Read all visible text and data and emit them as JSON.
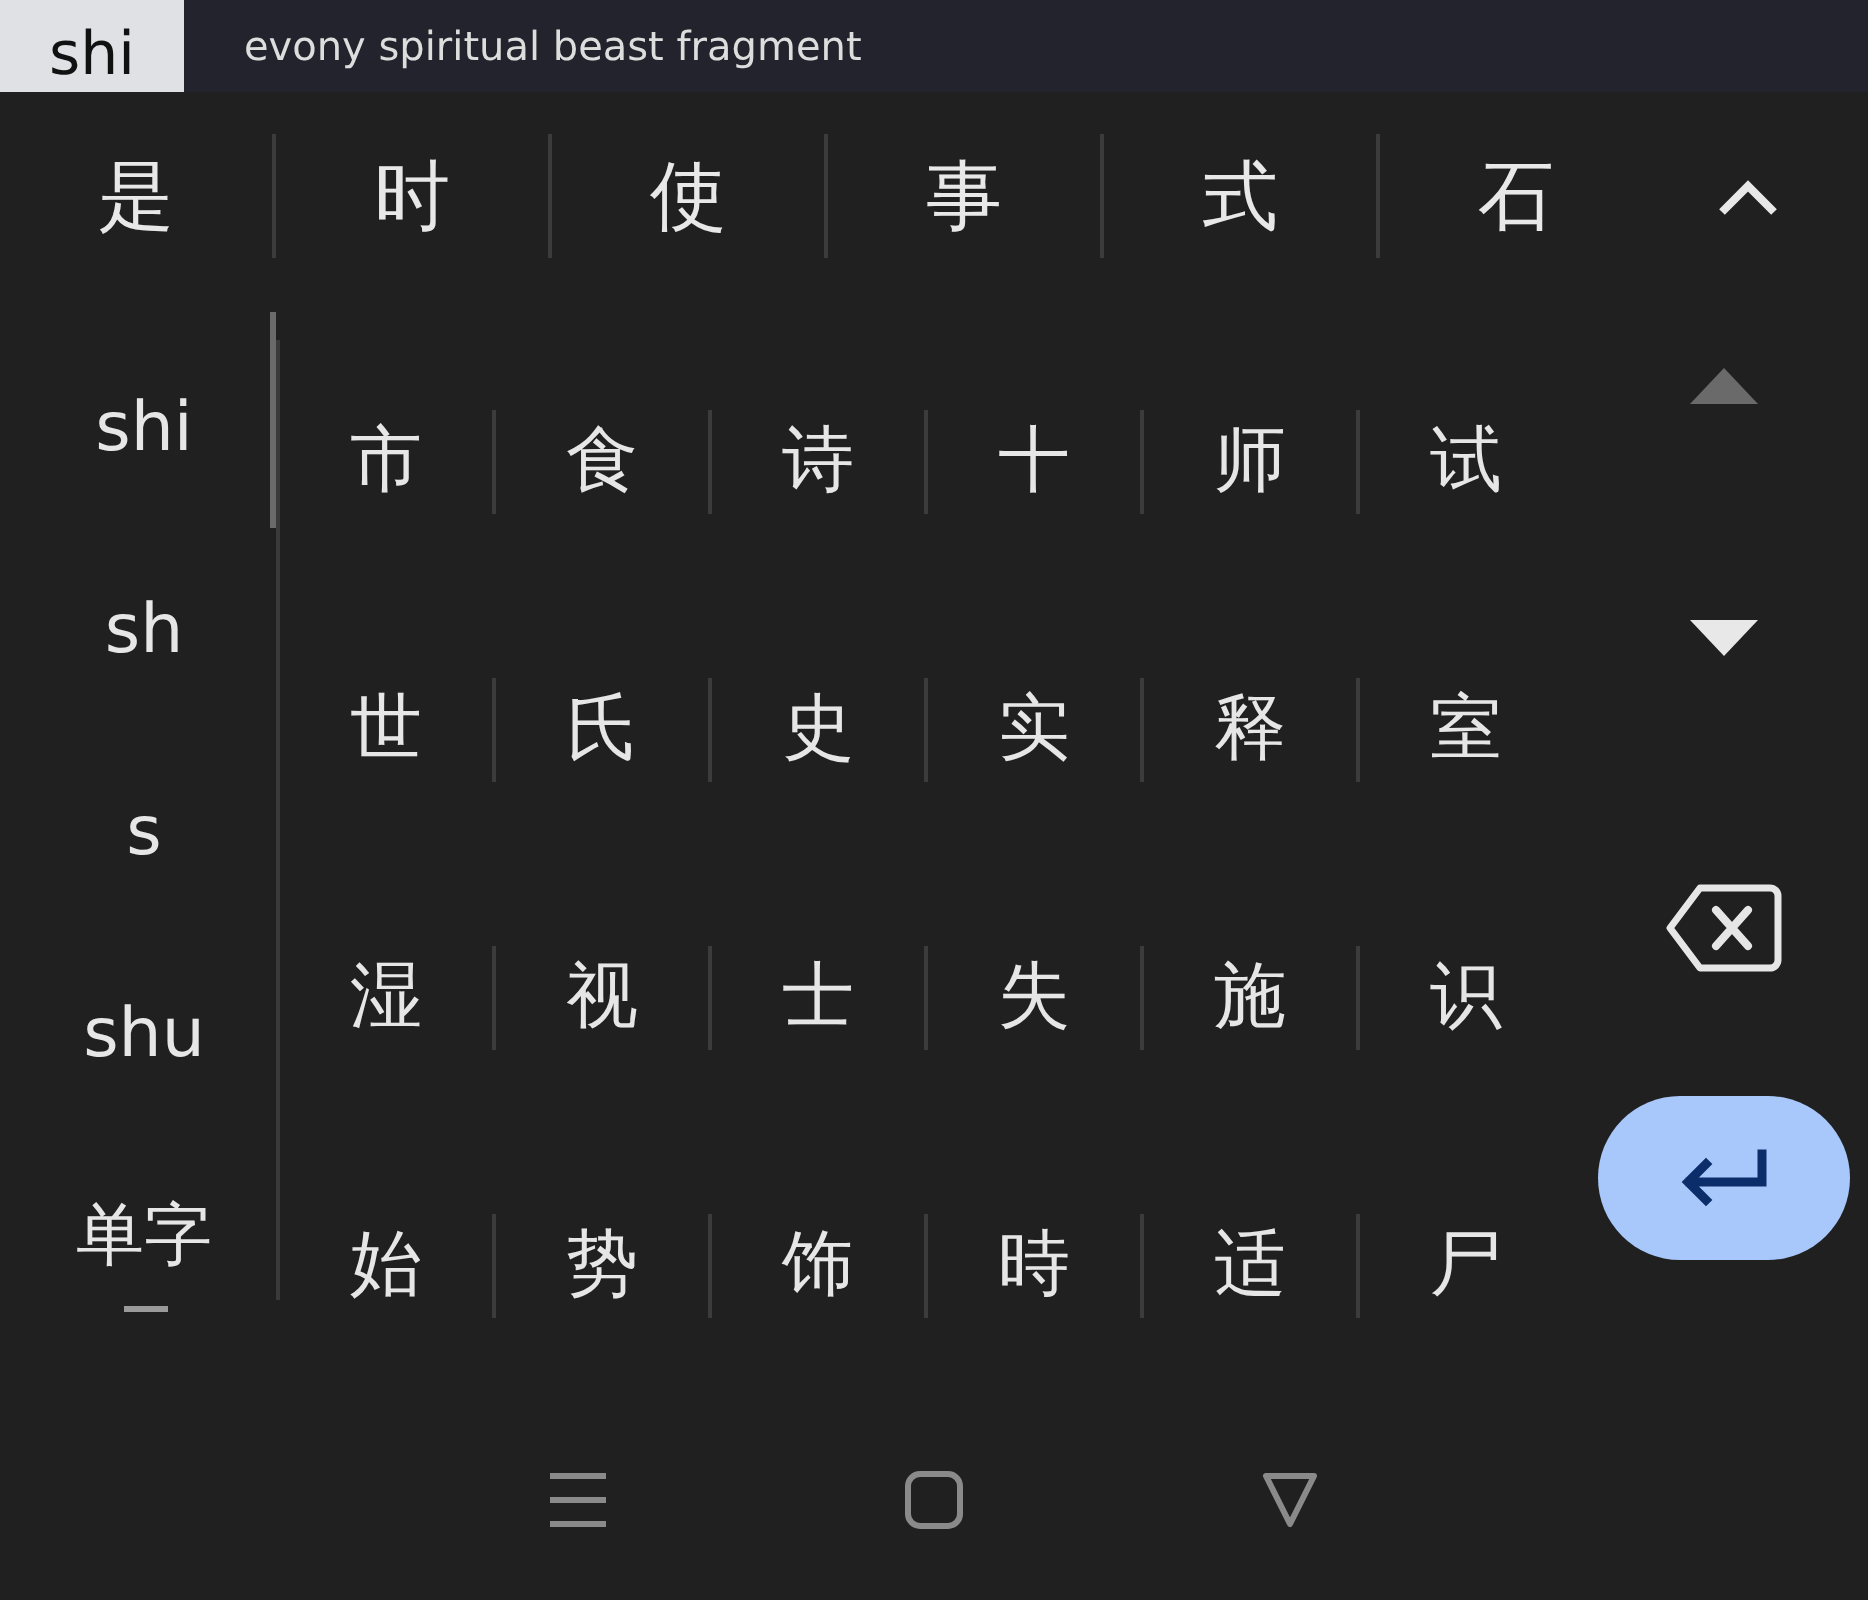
{
  "input_bar": {
    "composing": "shi",
    "text": "evony spiritual beast fragment"
  },
  "candidates": [
    "是",
    "时",
    "使",
    "事",
    "式",
    "石"
  ],
  "pinyin_options": [
    "shi",
    "sh",
    "s",
    "shu",
    "单字"
  ],
  "more_candidates": [
    [
      "市",
      "食",
      "诗",
      "十",
      "师",
      "试"
    ],
    [
      "世",
      "氏",
      "史",
      "实",
      "释",
      "室"
    ],
    [
      "湿",
      "视",
      "士",
      "失",
      "施",
      "识"
    ],
    [
      "始",
      "势",
      "饰",
      "時",
      "适",
      "尸"
    ]
  ],
  "page_up_disabled": true,
  "page_down_disabled": false
}
